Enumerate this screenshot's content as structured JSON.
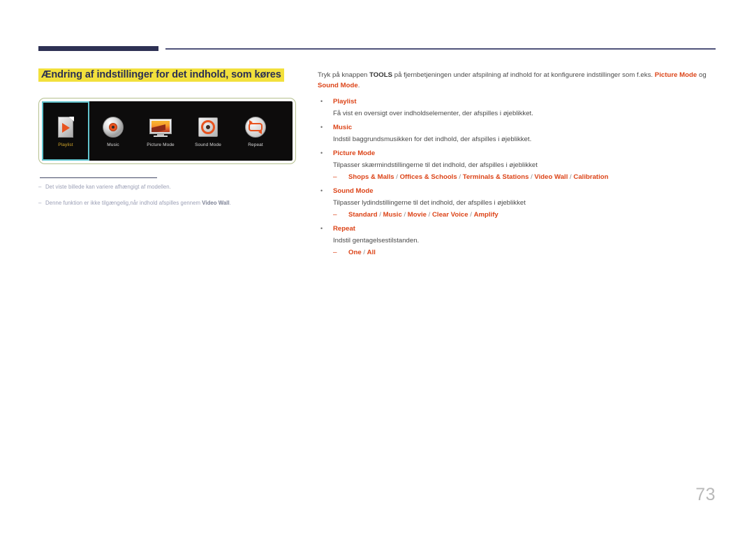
{
  "header": {
    "rule_color": "#2e3154",
    "thin_rule_color": "#50537a"
  },
  "title": {
    "text": "Ændring af indstillinger for det indhold, som køres",
    "highlight_color": "#f2e03c",
    "text_color": "#2b2f52"
  },
  "device_mock": {
    "frame_color": "#b5c08e",
    "screen_bg": "#0d0c0c",
    "selection_color": "#63c5cf",
    "selected_label_color": "#d4a82a",
    "tiles": [
      {
        "label": "Playlist",
        "icon": "playlist-document-play-icon",
        "selected": true
      },
      {
        "label": "Music",
        "icon": "music-cd-disc-icon",
        "selected": false
      },
      {
        "label": "Picture Mode",
        "icon": "picture-mode-tv-icon",
        "selected": false
      },
      {
        "label": "Sound Mode",
        "icon": "sound-mode-speaker-icon",
        "selected": false
      },
      {
        "label": "Repeat",
        "icon": "repeat-loop-arrows-icon",
        "selected": false
      }
    ]
  },
  "footnotes": {
    "dash": "–",
    "items": [
      {
        "pre": "Det viste billede kan variere afhængigt af modellen.",
        "bold": "",
        "post": ""
      },
      {
        "pre": "Denne funktion er ikke tilgængelig,når indhold afspilles gennem ",
        "bold": "Video Wall",
        "post": "."
      }
    ]
  },
  "intro": {
    "p1": "Tryk på knappen ",
    "bold_tools": "TOOLS",
    "p2": " på fjernbetjeningen under afspilning af indhold for at konfigurere indstillinger som f.eks. ",
    "bold_picture_mode": "Picture Mode",
    "p3": " og ",
    "bold_sound_mode": "Sound Mode",
    "p4": "."
  },
  "bullets": {
    "dot": "•",
    "dash": "–",
    "items": [
      {
        "head": "Playlist",
        "desc": "Få vist en oversigt over indholdselementer, der afspilles i øjeblikket.",
        "options": []
      },
      {
        "head": "Music",
        "desc": "Indstil baggrundsmusikken for det indhold, der afspilles i øjeblikket.",
        "options": []
      },
      {
        "head": "Picture Mode",
        "desc": "Tilpasser skærmindstillingerne til det indhold, der afspilles i øjeblikket",
        "options": [
          "Shops & Malls",
          "Offices & Schools",
          "Terminals & Stations",
          "Video Wall",
          "Calibration"
        ]
      },
      {
        "head": "Sound Mode",
        "desc": "Tilpasser lydindstillingerne til det indhold, der afspilles i øjeblikket",
        "options": [
          "Standard",
          "Music",
          "Movie",
          "Clear Voice",
          "Amplify"
        ]
      },
      {
        "head": "Repeat",
        "desc": "Indstil gentagelsestilstanden.",
        "options": [
          "One",
          "All"
        ]
      }
    ]
  },
  "page_number": "73",
  "colors": {
    "accent_red": "#dc4418",
    "navy": "#2e3154",
    "highlight_yellow": "#f2e03c",
    "body_gray": "#4a4a4a"
  }
}
